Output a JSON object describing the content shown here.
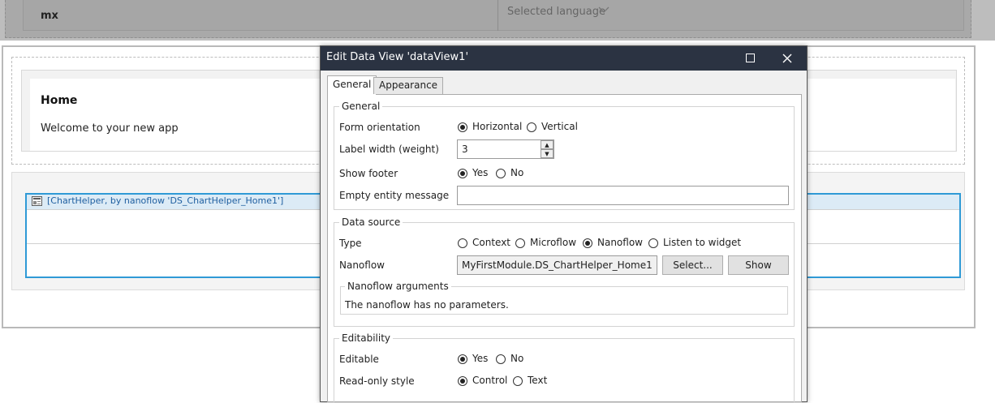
{
  "background": {
    "top_row": {
      "left": "mx",
      "right": "Selected language"
    },
    "home": {
      "title": "Home",
      "text": "Welcome to your new app"
    },
    "chart_widget": {
      "label": "[ChartHelper, by nanoflow 'DS_ChartHelper_Home1']"
    }
  },
  "dialog": {
    "title": "Edit Data View 'dataView1'",
    "tabs": [
      "General",
      "Appearance"
    ],
    "general": {
      "heading": "General",
      "form_orientation": {
        "label": "Form orientation",
        "options": [
          "Horizontal",
          "Vertical"
        ],
        "selected": "Horizontal"
      },
      "label_width": {
        "label": "Label width (weight)",
        "value": "3"
      },
      "show_footer": {
        "label": "Show footer",
        "options": [
          "Yes",
          "No"
        ],
        "selected": "Yes"
      },
      "empty_entity_message": {
        "label": "Empty entity message",
        "value": ""
      }
    },
    "data_source": {
      "heading": "Data source",
      "type": {
        "label": "Type",
        "options": [
          "Context",
          "Microflow",
          "Nanoflow",
          "Listen to widget"
        ],
        "selected": "Nanoflow"
      },
      "nanoflow": {
        "label": "Nanoflow",
        "value": "MyFirstModule.DS_ChartHelper_Home1",
        "select_button": "Select...",
        "show_button": "Show"
      },
      "arguments": {
        "heading": "Nanoflow arguments",
        "text": "The nanoflow has no parameters."
      }
    },
    "editability": {
      "heading": "Editability",
      "editable": {
        "label": "Editable",
        "options": [
          "Yes",
          "No"
        ],
        "selected": "Yes"
      },
      "readonly_style": {
        "label": "Read-only style",
        "options": [
          "Control",
          "Text"
        ],
        "selected": "Control"
      }
    }
  },
  "colors": {
    "titlebar": "#2b3342",
    "selection": "#2f9ad6"
  }
}
